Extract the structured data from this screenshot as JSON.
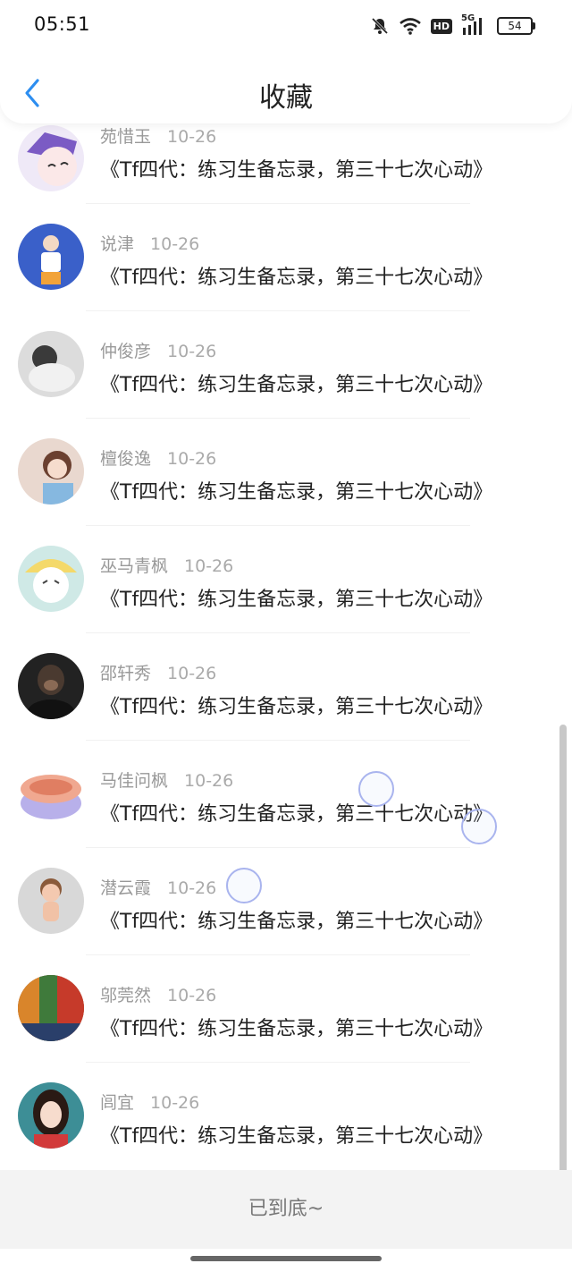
{
  "status_bar": {
    "time": "05:51",
    "icons": [
      "mute-bell-icon",
      "wifi-icon",
      "hd-icon",
      "5g-signal-icon",
      "battery-icon"
    ],
    "hd_label": "HD",
    "network_label": "5G",
    "battery": "54"
  },
  "header": {
    "back_icon": "chevron-left-icon",
    "title": "收藏"
  },
  "items": [
    {
      "name": "苑惜玉",
      "date": "10-26",
      "title": "《Tf四代：练习生备忘录，第三十七次心动》",
      "avatar_color": "#7b5bc4"
    },
    {
      "name": "说津",
      "date": "10-26",
      "title": "《Tf四代：练习生备忘录，第三十七次心动》",
      "avatar_color": "#3a60c9"
    },
    {
      "name": "仲俊彦",
      "date": "10-26",
      "title": "《Tf四代：练习生备忘录，第三十七次心动》",
      "avatar_color": "#dcdcdc"
    },
    {
      "name": "檀俊逸",
      "date": "10-26",
      "title": "《Tf四代：练习生备忘录，第三十七次心动》",
      "avatar_color": "#e9d8cf"
    },
    {
      "name": "巫马青枫",
      "date": "10-26",
      "title": "《Tf四代：练习生备忘录，第三十七次心动》",
      "avatar_color": "#cfe9e6"
    },
    {
      "name": "邵轩秀",
      "date": "10-26",
      "title": "《Tf四代：练习生备忘录，第三十七次心动》",
      "avatar_color": "#222222"
    },
    {
      "name": "马佳问枫",
      "date": "10-26",
      "title": "《Tf四代：练习生备忘录，第三十七次心动》",
      "avatar_color": "#f1e0e6"
    },
    {
      "name": "潜云霞",
      "date": "10-26",
      "title": "《Tf四代：练习生备忘录，第三十七次心动》",
      "avatar_color": "#d8d8d8"
    },
    {
      "name": "邬莞然",
      "date": "10-26",
      "title": "《Tf四代：练习生备忘录，第三十七次心动》",
      "avatar_color": "#8a3d1c"
    },
    {
      "name": "闾宜",
      "date": "10-26",
      "title": "《Tf四代：练习生备忘录，第三十七次心动》",
      "avatar_color": "#3d8e96"
    }
  ],
  "footer": {
    "text": "已到底~"
  },
  "colors": {
    "accent": "#2d8ef0",
    "name_gray": "#999999",
    "footer_bg": "#f3f3f3"
  }
}
